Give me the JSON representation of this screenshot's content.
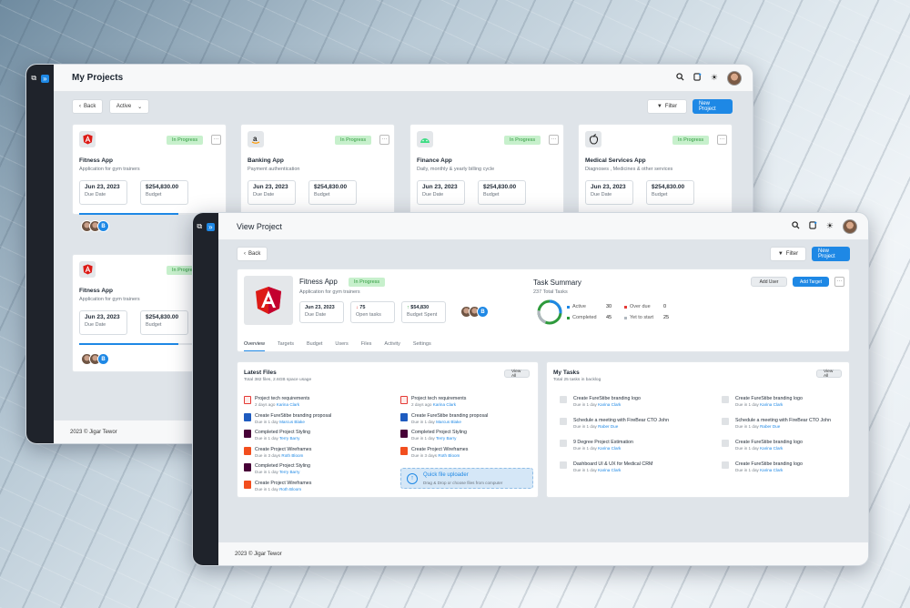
{
  "colors": {
    "accent": "#1e88e5",
    "badge_bg": "#c7f0cc",
    "badge_fg": "#2e9a3c",
    "sidebar": "#1f232b"
  },
  "back_window": {
    "title": "My Projects",
    "back_label": "Back",
    "status_select": "Active",
    "filter_label": "Filter",
    "new_project_label": "New Project",
    "footer": "2023 © Jigar Tewor",
    "cards": [
      {
        "icon": "angular-icon",
        "status": "In Progress",
        "name": "Fitness App",
        "desc": "Application for gym trainers",
        "date": "Jun 23, 2023",
        "date_label": "Due Date",
        "budget": "$254,830.00",
        "budget_label": "Budget",
        "progress": 0.7,
        "avatar_letter": "B"
      },
      {
        "icon": "amazon-icon",
        "status": "In Progress",
        "name": "Banking App",
        "desc": "Payment authentication",
        "date": "Jun 23, 2023",
        "date_label": "Due Date",
        "budget": "$254,830.00",
        "budget_label": "Budget",
        "progress": 0.7
      },
      {
        "icon": "android-icon",
        "status": "In Progress",
        "name": "Finance App",
        "desc": "Daily, monthly & yearly billing cycle",
        "date": "Jun 23, 2023",
        "date_label": "Due Date",
        "budget": "$254,830.00",
        "budget_label": "Budget",
        "progress": 0.7
      },
      {
        "icon": "apple-icon",
        "status": "In Progress",
        "name": "Medical Services App",
        "desc": "Diagnoses , Medicines & other services",
        "date": "Jun 23, 2023",
        "date_label": "Due Date",
        "budget": "$254,830.00",
        "budget_label": "Budget",
        "progress": 0.7
      },
      {
        "icon": "angular-icon",
        "status": "In Progress",
        "name": "Fitness App",
        "desc": "Application for gym trainers",
        "date": "Jun 23, 2023",
        "date_label": "Due Date",
        "budget": "$254,830.00",
        "budget_label": "Budget",
        "progress": 0.7,
        "avatar_letter": "B"
      }
    ]
  },
  "front_window": {
    "title": "View Project",
    "back_label": "Back",
    "filter_label": "Filter",
    "new_project_label": "New Project",
    "project": {
      "name": "Fitness App",
      "status": "In Progress",
      "desc": "Application for gym trainers",
      "date": "Jun 23, 2023",
      "date_label": "Due Date",
      "open_tasks": "75",
      "open_tasks_label": "Open tasks",
      "budget": "$54,830",
      "budget_label": "Budget Spent",
      "avatar_letter": "B"
    },
    "task_summary": {
      "title": "Task Summary",
      "total": "237 Total Tasks",
      "add_user": "Add User",
      "add_target": "Add Target",
      "legend": [
        {
          "label": "Active",
          "value": "30",
          "color": "#1e88e5"
        },
        {
          "label": "Over due",
          "value": "0",
          "color": "#e53935"
        },
        {
          "label": "Completed",
          "value": "45",
          "color": "#2e9a3c"
        },
        {
          "label": "Yet to start",
          "value": "25",
          "color": "#b0b7be"
        }
      ]
    },
    "tabs": [
      "Overview",
      "Targets",
      "Budget",
      "Users",
      "Files",
      "Activity",
      "Settings"
    ],
    "files": {
      "title": "Latest Files",
      "subtitle": "Total 382 files, 2.6GB space usage",
      "view_all": "View All",
      "left": [
        {
          "type": "pdf",
          "name": "Project tech requirements",
          "meta": "2 days ago",
          "who": "Karina Clark"
        },
        {
          "type": "word",
          "name": "Create FureStibe branding proposal",
          "meta": "Due in 1 day",
          "who": "Marcus Blake"
        },
        {
          "type": "xd",
          "name": "Completed Project Styling",
          "meta": "Due in 1 day",
          "who": "Terry Barry"
        },
        {
          "type": "figma",
          "name": "Create Project Wireframes",
          "meta": "Due in 3 days",
          "who": "Roth Bloom"
        },
        {
          "type": "xd",
          "name": "Completed Project Styling",
          "meta": "Due in 1 day",
          "who": "Terry Barry"
        },
        {
          "type": "figma",
          "name": "Create Project Wireframes",
          "meta": "Due in 1 day",
          "who": "Roth Bloom"
        }
      ],
      "right": [
        {
          "type": "pdf",
          "name": "Project tech requirements",
          "meta": "2 days ago",
          "who": "Karina Clark"
        },
        {
          "type": "word",
          "name": "Create FureStibe branding proposal",
          "meta": "Due in 1 day",
          "who": "Marcus Blake"
        },
        {
          "type": "xd",
          "name": "Completed Project Styling",
          "meta": "Due in 1 day",
          "who": "Terry Barry"
        },
        {
          "type": "figma",
          "name": "Create Project Wireframes",
          "meta": "Due in 3 days",
          "who": "Roth Bloom"
        }
      ],
      "uploader_title": "Quick file uploader",
      "uploader_sub": "Drag & Drop or choose files from computer"
    },
    "tasks": {
      "title": "My Tasks",
      "subtitle": "Total 25 tasks in backlog",
      "view_all": "View All",
      "left": [
        {
          "name": "Create FureStibe branding logo",
          "meta": "Due in 1 day",
          "who": "Karina Clark"
        },
        {
          "name": "Schedule a meeting with FireBear CTO John",
          "meta": "Due in 1 day",
          "who": "Raber Due"
        },
        {
          "name": "9 Degree Project Estimation",
          "meta": "Due in 1 day",
          "who": "Karina Clark"
        },
        {
          "name": "Dashboard UI & UX for Medical CRM",
          "meta": "Due in 1 day",
          "who": "Karina Clark"
        }
      ],
      "right": [
        {
          "name": "Create FureStibe branding logo",
          "meta": "Due in 1 day",
          "who": "Karina Clark"
        },
        {
          "name": "Schedule a meeting with FireBear CTO John",
          "meta": "Due in 1 day",
          "who": "Raber Due"
        },
        {
          "name": "Create FureStibe branding logo",
          "meta": "Due in 1 day",
          "who": "Karina Clark"
        },
        {
          "name": "Create FureStibe branding logo",
          "meta": "Due in 1 day",
          "who": "Karina Clark"
        }
      ]
    },
    "footer": "2023 © Jigar Tewor"
  }
}
